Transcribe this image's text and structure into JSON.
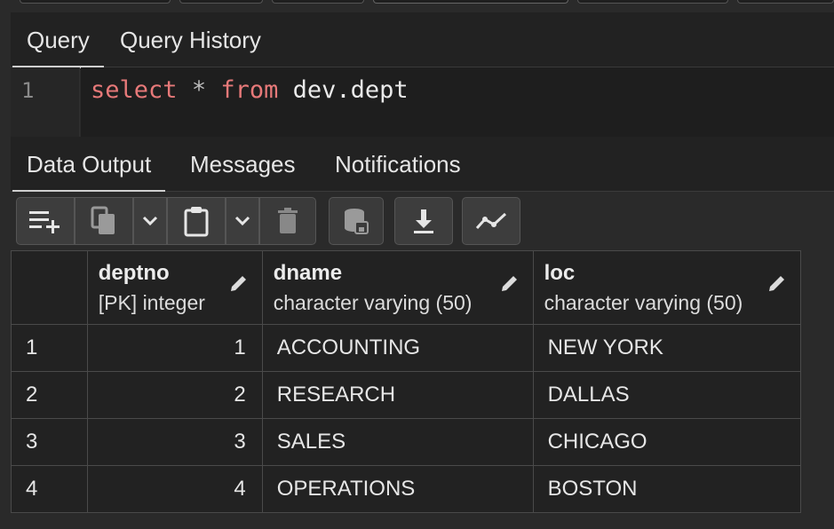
{
  "query_tabs": [
    "Query",
    "Query History"
  ],
  "editor": {
    "line_number": "1",
    "tokens": {
      "select": "select",
      "star": "*",
      "from": "from",
      "table": "dev.dept"
    }
  },
  "output_tabs": [
    "Data Output",
    "Messages",
    "Notifications"
  ],
  "toolbar_icons": [
    "add-row-icon",
    "copy-icon",
    "chevron-down-icon",
    "paste-icon",
    "chevron-down-icon",
    "delete-icon",
    "save-data-icon",
    "download-icon",
    "graph-icon"
  ],
  "columns": [
    {
      "name": "deptno",
      "type": "[PK] integer"
    },
    {
      "name": "dname",
      "type": "character varying (50)"
    },
    {
      "name": "loc",
      "type": "character varying (50)"
    }
  ],
  "rows": [
    {
      "num": "1",
      "deptno": "1",
      "dname": "ACCOUNTING",
      "loc": "NEW YORK"
    },
    {
      "num": "2",
      "deptno": "2",
      "dname": "RESEARCH",
      "loc": "DALLAS"
    },
    {
      "num": "3",
      "deptno": "3",
      "dname": "SALES",
      "loc": "CHICAGO"
    },
    {
      "num": "4",
      "deptno": "4",
      "dname": "OPERATIONS",
      "loc": "BOSTON"
    }
  ],
  "colors": {
    "keyword": "#e77979",
    "background": "#222222",
    "border": "#4a4a4a"
  }
}
